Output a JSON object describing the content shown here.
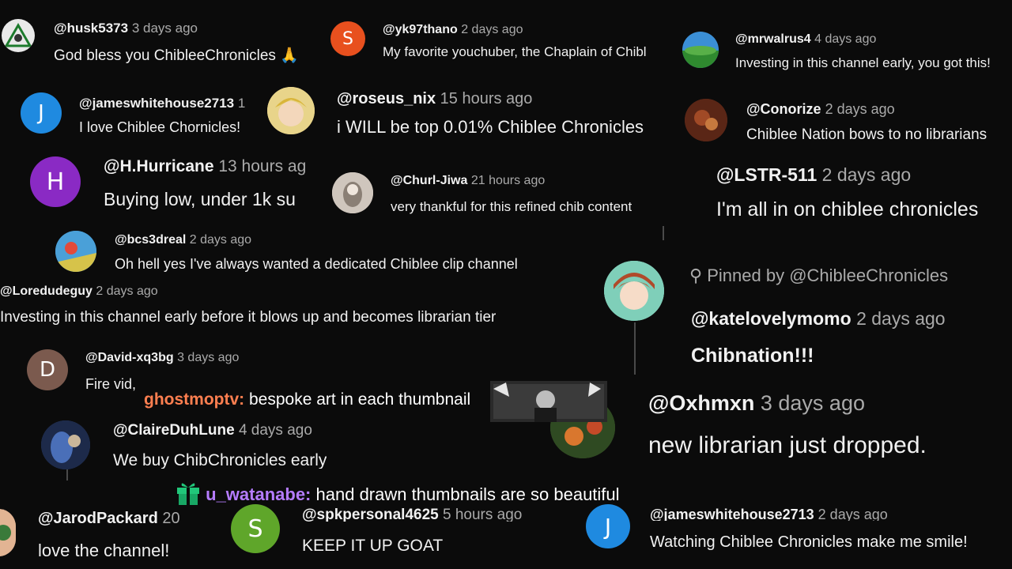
{
  "colors": {
    "background": "#0b0b0b",
    "text": "#f1f1f1",
    "meta": "#aaaaaa",
    "chat_user_1": "#ff7f50",
    "chat_user_2": "#b57cff",
    "avatar_s_orange": "#e8501e",
    "avatar_j_blue": "#1f8ae0",
    "avatar_h_purple": "#8a2ac4",
    "avatar_d_brown": "#7b5a4e",
    "avatar_s_green": "#5fa62a"
  },
  "comments": [
    {
      "handle": "@husk5373",
      "time": "3 days ago",
      "text": "God bless you ChibleeChronicles 🙏"
    },
    {
      "handle": "@yk97thano",
      "time": "2 days ago",
      "text": "My favorite youchuber, the Chaplain of Chibl",
      "avatar_letter": "S"
    },
    {
      "handle": "@mrwalrus4",
      "time": "4 days ago",
      "text": "Investing in this channel early, you got this!"
    },
    {
      "handle": "@jameswhitehouse2713",
      "time": "1",
      "text": "I love Chiblee Chornicles!",
      "avatar_letter": "J"
    },
    {
      "handle": "@roseus_nix",
      "time": "15 hours ago",
      "text": "i WILL be top 0.01% Chiblee Chronicles"
    },
    {
      "handle": "@Conorize",
      "time": "2 days ago",
      "text": "Chiblee Nation bows to no librarians"
    },
    {
      "handle": "@H.Hurricane",
      "time": "13 hours ag",
      "text": "Buying low, under 1k su",
      "avatar_letter": "H"
    },
    {
      "handle": "@Churl-Jiwa",
      "time": "21 hours ago",
      "text": "very thankful for this refined chib content"
    },
    {
      "handle": "@LSTR-511",
      "time": "2 days ago",
      "text": "I'm all in on chiblee chronicles"
    },
    {
      "handle": "@bcs3dreal",
      "time": "2 days ago",
      "text": "Oh hell yes I've always wanted a dedicated Chiblee clip channel"
    },
    {
      "handle": "@Loredudeguy",
      "time": "2 days ago",
      "text": "Investing in this channel early before it blows up and becomes librarian tier"
    },
    {
      "handle": "@katelovelymomo",
      "time": "2 days ago",
      "text": "Chibnation!!!",
      "pinned": "Pinned by @ChibleeChronicles"
    },
    {
      "handle": "@David-xq3bg",
      "time": "3 days ago",
      "text": "Fire vid,",
      "avatar_letter": "D"
    },
    {
      "handle": "@Oxhmxn",
      "time": "3 days ago",
      "text": "new librarian just dropped."
    },
    {
      "handle": "@ClaireDuhLune",
      "time": "4 days ago",
      "text": "We buy ChibChronicles early"
    },
    {
      "handle": "@JarodPackard",
      "time": "20",
      "text": "love the channel!"
    },
    {
      "handle": "@spkpersonal4625",
      "time": "5 hours ago",
      "text": "KEEP IT UP GOAT",
      "avatar_letter": "S"
    },
    {
      "handle": "@jameswhitehouse2713",
      "time": "2 days ago",
      "text": "Watching Chiblee Chronicles make me smile!",
      "avatar_letter": "J"
    }
  ],
  "chat": [
    {
      "user": "ghostmoptv:",
      "message": "bespoke art in each thumbnail"
    },
    {
      "user": "u_watanabe:",
      "message": "hand drawn thumbnails are so beautiful",
      "icon": "gift-icon"
    }
  ]
}
